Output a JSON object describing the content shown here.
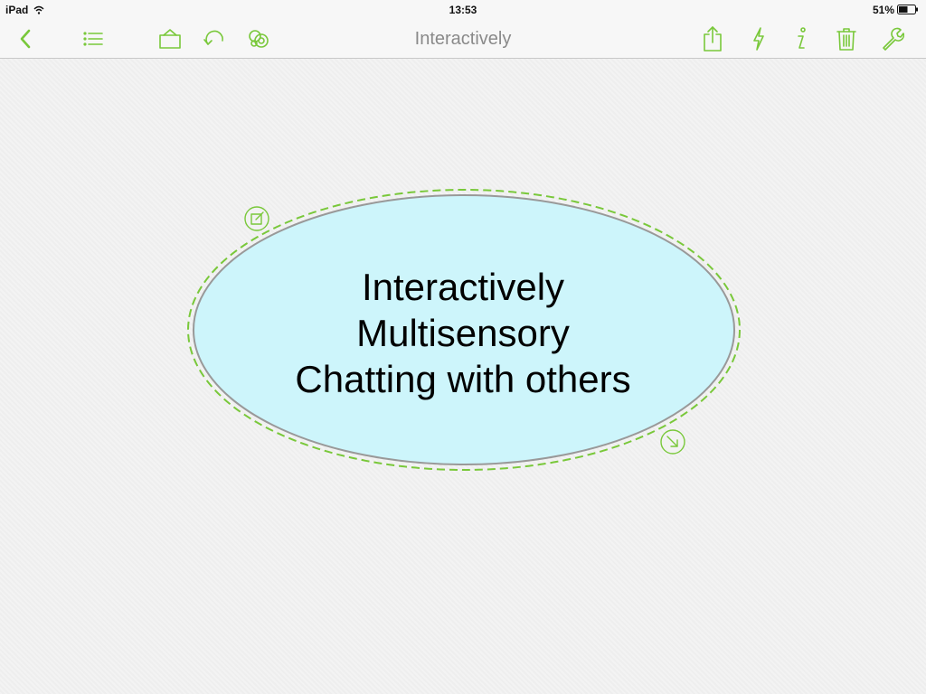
{
  "status_bar": {
    "device": "iPad",
    "time": "13:53",
    "battery": "51%",
    "wifi_icon": "wifi-icon",
    "battery_icon": "battery-icon"
  },
  "toolbar": {
    "title": "Interactively",
    "accent_color": "#79c83a",
    "left_buttons": [
      {
        "name": "back-button",
        "icon": "chevron-left-icon"
      },
      {
        "name": "outline-button",
        "icon": "list-icon"
      },
      {
        "name": "canvas-button",
        "icon": "canvas-icon"
      },
      {
        "name": "undo-button",
        "icon": "undo-icon"
      },
      {
        "name": "style-button",
        "icon": "circles-icon"
      }
    ],
    "right_buttons": [
      {
        "name": "share-button",
        "icon": "share-icon"
      },
      {
        "name": "quick-action-button",
        "icon": "lightning-icon"
      },
      {
        "name": "info-button",
        "icon": "info-icon"
      },
      {
        "name": "delete-button",
        "icon": "trash-icon"
      },
      {
        "name": "settings-button",
        "icon": "wrench-icon"
      }
    ]
  },
  "node": {
    "lines": [
      "Interactively",
      "Multisensory",
      "Chatting with others"
    ],
    "fill_color": "#cdf5fb",
    "border_color": "#999999",
    "selection_color": "#79c83a",
    "edit_handle_icon": "edit-icon",
    "resize_handle_icon": "resize-arrow-icon"
  }
}
